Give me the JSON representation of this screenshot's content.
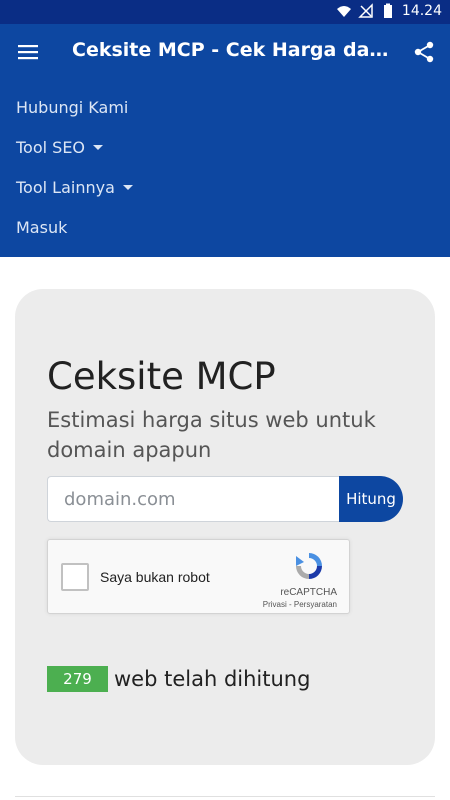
{
  "status_bar": {
    "time": "14.24",
    "icons": [
      "wifi-icon",
      "signal-off-icon",
      "battery-icon"
    ]
  },
  "app_bar": {
    "title": "Ceksite MCP - Cek Harga dan Pen…",
    "menu_icon": "hamburger-menu-icon",
    "share_icon": "share-icon"
  },
  "nav": {
    "items": [
      {
        "label": "Hubungi Kami",
        "dropdown": false
      },
      {
        "label": "Tool SEO",
        "dropdown": true
      },
      {
        "label": "Tool Lainnya",
        "dropdown": true
      },
      {
        "label": "Masuk",
        "dropdown": false
      }
    ]
  },
  "hero": {
    "heading": "Ceksite MCP",
    "subheading": "Estimasi harga situs web untuk domain apapun",
    "input_placeholder": "domain.com",
    "input_value": "",
    "submit_label": "Hitung"
  },
  "recaptcha": {
    "label": "Saya bukan robot",
    "brand": "reCAPTCHA",
    "links": "Privasi - Persyaratan"
  },
  "counter": {
    "count": "279",
    "label": "web telah dihitung"
  },
  "colors": {
    "primary": "#0d47a1",
    "status_bar": "#0a2d85",
    "card_bg": "#ececec",
    "badge_green": "#4caf50"
  }
}
